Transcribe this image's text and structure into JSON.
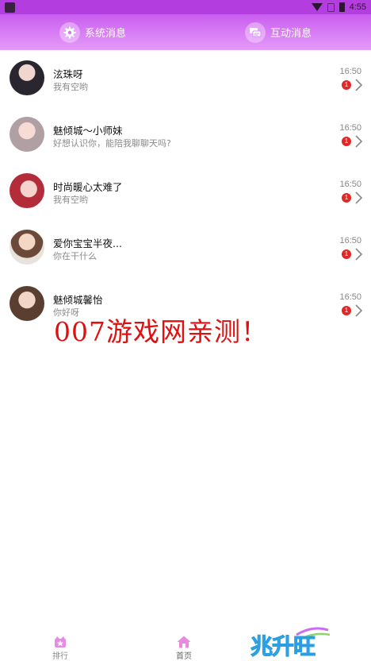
{
  "status_bar": {
    "time": "4:55"
  },
  "header": {
    "tabs": [
      {
        "label": "系统消息",
        "icon": "gear-icon"
      },
      {
        "label": "互动消息",
        "icon": "chat-icon"
      }
    ]
  },
  "messages": [
    {
      "name": "泫珠呀",
      "preview": "我有空哟",
      "time": "16:50",
      "unread": "1"
    },
    {
      "name": "魅倾城～小师妹",
      "preview": "好想认识你，能陪我聊聊天吗?",
      "time": "16:50",
      "unread": "1"
    },
    {
      "name": "时尚暖心太难了",
      "preview": "我有空哟",
      "time": "16:50",
      "unread": "1"
    },
    {
      "name": "爱你宝宝半夜...",
      "preview": "你在干什么",
      "time": "16:50",
      "unread": "1"
    },
    {
      "name": "魅倾城馨怡",
      "preview": "你好呀",
      "time": "16:50",
      "unread": "1"
    }
  ],
  "watermark": "007游戏网亲测！",
  "bottom_nav": {
    "items": [
      {
        "label": "排行",
        "icon": "rank-icon"
      },
      {
        "label": "首页",
        "icon": "home-icon"
      }
    ]
  },
  "logo_text": "兆升旺",
  "colors": {
    "header_top": "#c95ef0",
    "header_bottom": "#e59af9",
    "badge": "#e02828",
    "watermark": "#e01010",
    "nav_icon": "#e58ce0"
  }
}
